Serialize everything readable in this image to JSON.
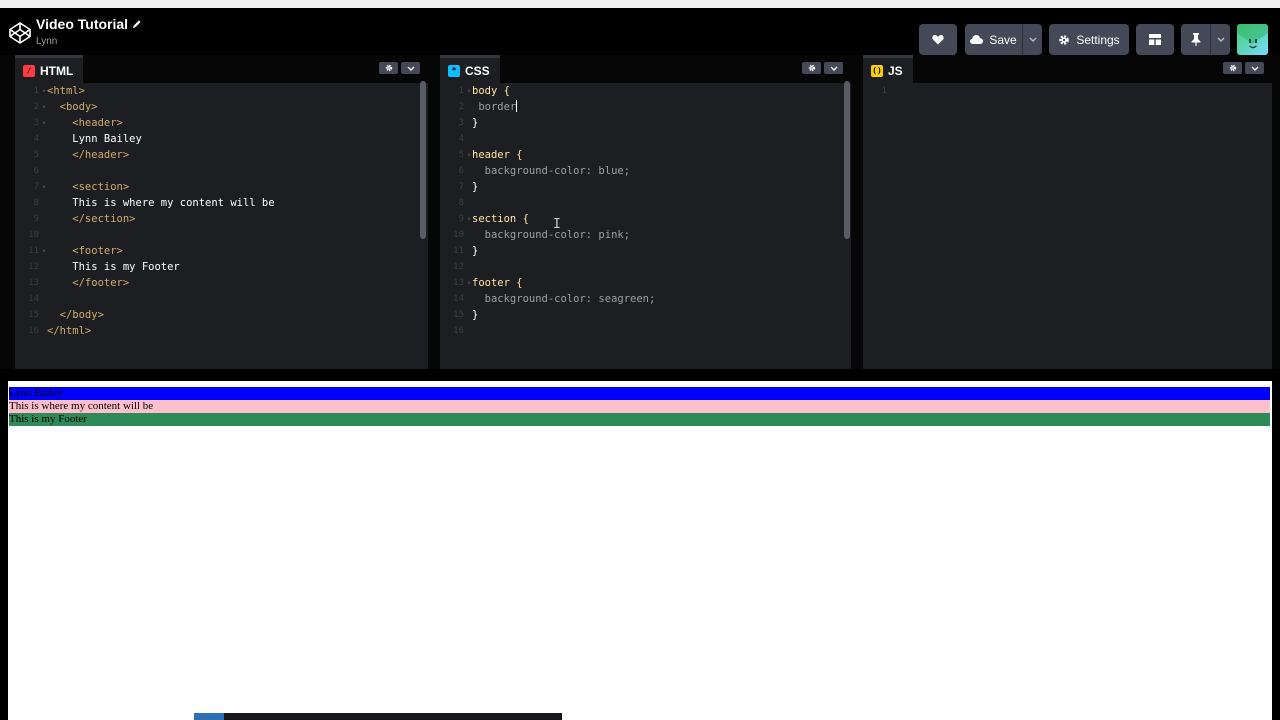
{
  "app": {
    "title": "Video Tutorial",
    "owner": "Lynn"
  },
  "toolbar": {
    "save_label": "Save",
    "settings_label": "Settings"
  },
  "editors": {
    "html": {
      "label": "HTML",
      "lines": [
        [
          "<html>"
        ],
        [
          "  <body>"
        ],
        [
          "    <header>"
        ],
        [
          "    Lynn Bailey"
        ],
        [
          "    </header>"
        ],
        [
          ""
        ],
        [
          "    <section>"
        ],
        [
          "    This is where my content will be"
        ],
        [
          "    </section>"
        ],
        [
          ""
        ],
        [
          "    <footer>"
        ],
        [
          "    This is my Footer"
        ],
        [
          "    </footer>"
        ],
        [
          ""
        ],
        [
          "  </body>"
        ],
        [
          "</html>"
        ]
      ]
    },
    "css": {
      "label": "CSS",
      "lines": [
        "body {",
        " border",
        "}",
        "",
        "header {",
        "  background-color: blue;",
        "}",
        "",
        "section {",
        "  background-color: pink;",
        "}",
        "",
        "footer {",
        "  background-color: seagreen;",
        "}",
        ""
      ]
    },
    "js": {
      "label": "JS",
      "lines": [
        ""
      ]
    }
  },
  "preview": {
    "header_text": "Lynn Bailey",
    "section_text": "This is where my content will be",
    "footer_text": "This is my Footer",
    "header_color": "#0000ff",
    "section_color": "#ffc0cb",
    "footer_color": "#2e8b57"
  },
  "colors": {
    "ui_button": "#444857",
    "editor_bg": "#1d1e22",
    "html_badge": "#ff3c41",
    "css_badge": "#0ebeff",
    "js_badge": "#fcd000"
  },
  "icons": {
    "logo": "codepen-logo-icon",
    "pencil": "pencil-icon",
    "heart": "heart-icon",
    "cloud": "cloud-icon",
    "gear": "gear-icon",
    "layout": "layout-icon",
    "pin": "pin-icon",
    "chevron": "chevron-down-icon"
  }
}
